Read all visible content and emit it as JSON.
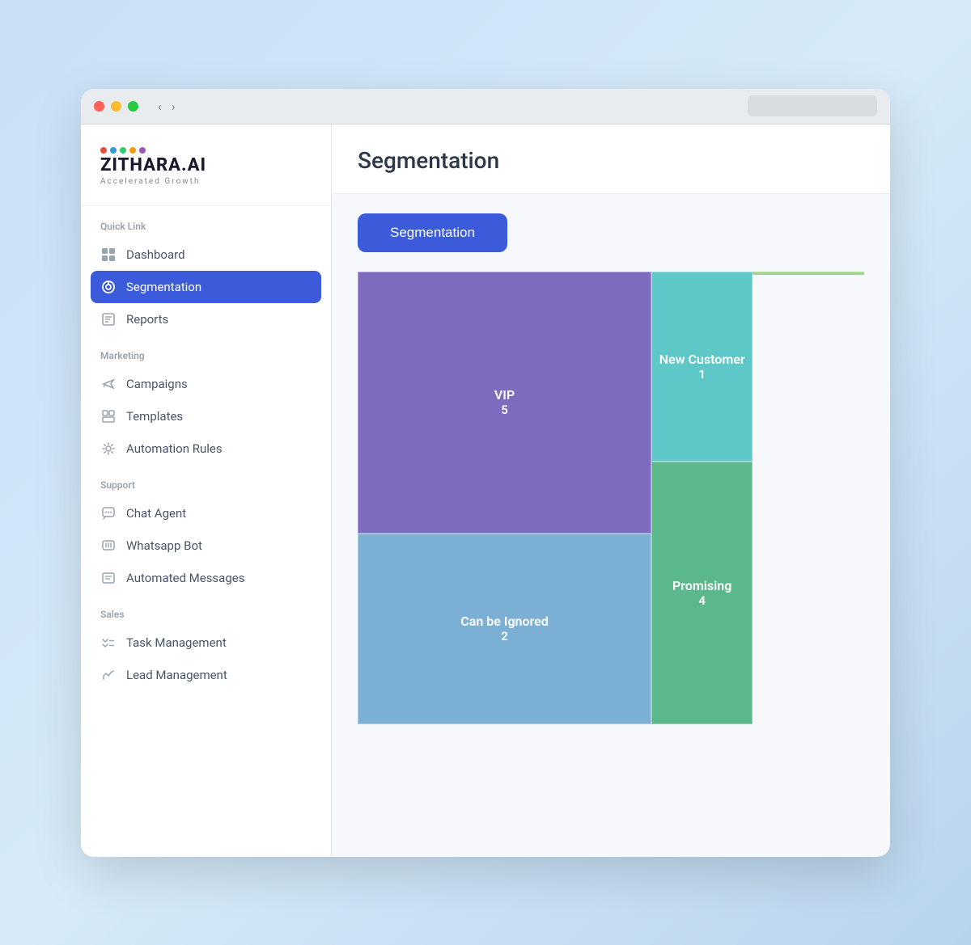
{
  "browser": {
    "url_placeholder": ""
  },
  "logo": {
    "text": "ZITHARA.AI",
    "subtitle": "Accelerated Growth",
    "dots": [
      "#e74c3c",
      "#3498db",
      "#2ecc71",
      "#f39c12",
      "#9b59b6"
    ]
  },
  "sidebar": {
    "quick_link_label": "Quick Link",
    "marketing_label": "Marketing",
    "support_label": "Support",
    "sales_label": "Sales",
    "items_quick": [
      {
        "id": "dashboard",
        "label": "Dashboard",
        "icon": "grid"
      },
      {
        "id": "segmentation",
        "label": "Segmentation",
        "icon": "target",
        "active": true
      },
      {
        "id": "reports",
        "label": "Reports",
        "icon": "report"
      }
    ],
    "items_marketing": [
      {
        "id": "campaigns",
        "label": "Campaigns",
        "icon": "megaphone"
      },
      {
        "id": "templates",
        "label": "Templates",
        "icon": "layout"
      },
      {
        "id": "automation-rules",
        "label": "Automation Rules",
        "icon": "gear"
      }
    ],
    "items_support": [
      {
        "id": "chat-agent",
        "label": "Chat Agent",
        "icon": "chat"
      },
      {
        "id": "whatsapp-bot",
        "label": "Whatsapp Bot",
        "icon": "whatsapp"
      },
      {
        "id": "automated-messages",
        "label": "Automated Messages",
        "icon": "message"
      }
    ],
    "items_sales": [
      {
        "id": "task-management",
        "label": "Task Management",
        "icon": "tasks"
      },
      {
        "id": "lead-management",
        "label": "Lead Management",
        "icon": "leads"
      }
    ]
  },
  "main": {
    "page_title": "Segmentation",
    "segmentation_button_label": "Segmentation"
  },
  "treemap": {
    "cells": [
      {
        "id": "vip",
        "label": "VIP",
        "value": "5",
        "color": "#7c6bbf"
      },
      {
        "id": "new-customer",
        "label": "New Customer",
        "value": "1",
        "color": "#5ec8c8"
      },
      {
        "id": "can-be-ignored",
        "label": "Can be Ignored",
        "value": "2",
        "color": "#5ab88a"
      },
      {
        "id": "promising",
        "label": "Promising",
        "value": "4",
        "color": "#7bafd4"
      },
      {
        "id": "green-area",
        "label": "",
        "value": "",
        "color": "#8dc96b"
      }
    ]
  }
}
